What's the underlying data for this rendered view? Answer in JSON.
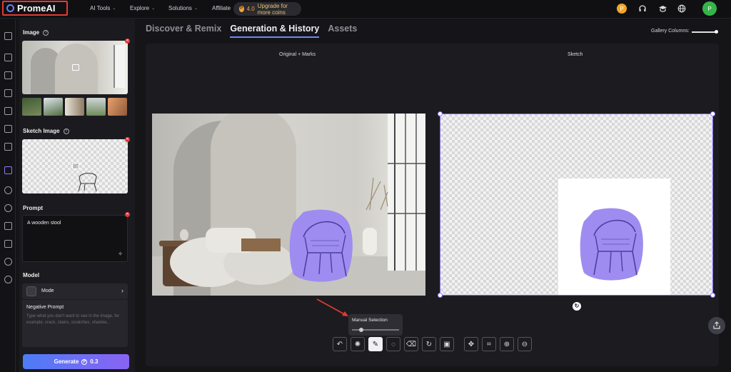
{
  "header": {
    "logo_text": "PromeAI",
    "nav": [
      {
        "label": "AI Tools",
        "chevron": true
      },
      {
        "label": "Explore",
        "chevron": true
      },
      {
        "label": "Solutions",
        "chevron": true
      },
      {
        "label": "Affiliate",
        "chevron": false
      }
    ],
    "coins": {
      "value": "4.0",
      "upgrade_label": "Upgrade for more coins"
    },
    "avatar_initial": "P",
    "icons": [
      "coin-icon",
      "headset-icon",
      "graduation-cap-icon",
      "globe-icon"
    ]
  },
  "rail": {
    "icons": [
      "home-icon",
      "video-icon",
      "chip-icon",
      "image-icon",
      "photo-edit-icon",
      "layers-icon",
      "grid-icon",
      "crown-icon",
      "compass-icon",
      "target-icon",
      "bell-icon",
      "folder-icon",
      "user-icon",
      "users-icon"
    ],
    "active": "crown-icon"
  },
  "panel": {
    "image_title": "Image",
    "sketch_title": "Sketch Image",
    "prompt_title": "Prompt",
    "prompt_value": "A wooden stool",
    "model_title": "Model",
    "mode_label": "Mode",
    "negative_title": "Negative Prompt",
    "negative_placeholder": "Type what you don't want to see in the image, for example, crack, stains, scratches, shadow...",
    "generate_label": "Generate",
    "generate_cost": "0.3"
  },
  "tabs": [
    {
      "label": "Discover & Remix",
      "active": false
    },
    {
      "label": "Generation & History",
      "active": true
    },
    {
      "label": "Assets",
      "active": false
    }
  ],
  "gallery_columns_label": "Gallery Columns:",
  "canvas": {
    "left_title": "Original + Marks",
    "right_title": "Sketch"
  },
  "tooltip": {
    "label": "Manual Selection",
    "level": 0.15
  },
  "toolbar": {
    "tools": [
      "undo-icon",
      "auto-select-icon",
      "brush-icon",
      "lasso-icon",
      "eraser-icon",
      "redo-icon",
      "mask-icon",
      "move-icon",
      "crop-icon",
      "zoom-in-icon",
      "zoom-out-icon"
    ],
    "active": "brush-icon"
  },
  "colors": {
    "accent": "#7b68ee",
    "mark_purple": "#9f8cf0",
    "generate_start": "#4d7cf6",
    "generate_end": "#8a63f3",
    "delete_red": "#e53935"
  }
}
